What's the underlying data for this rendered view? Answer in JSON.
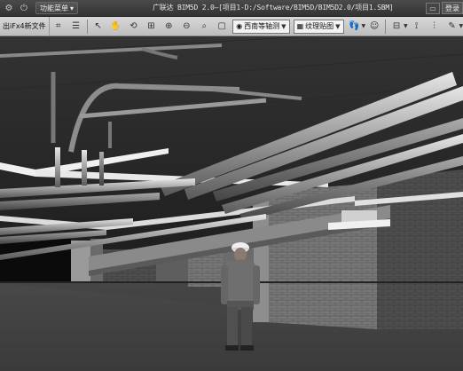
{
  "titlebar": {
    "menu_label": "功能菜单",
    "title": "广联达 BIM5D 2.0—[项目1-D:/Software/BIM5D/BIM5D2.0/项目1.SBM]",
    "login_label": "登录"
  },
  "toolbar": {
    "file_tab": "出iFx4新文件",
    "view_dropdown": "西南等轴测",
    "texture_dropdown": "纹理贴图"
  },
  "viewport": {
    "scene": "3D BIM model view"
  }
}
